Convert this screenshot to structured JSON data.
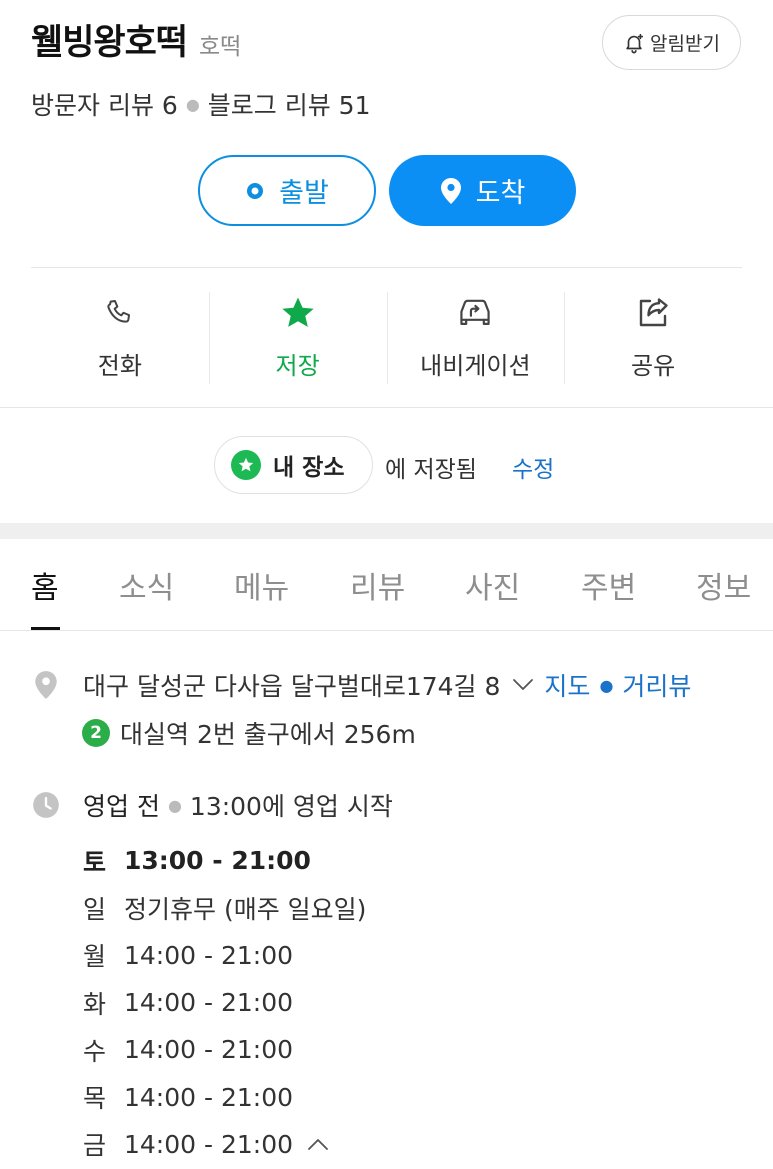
{
  "header": {
    "place_name": "웰빙왕호떡",
    "category": "호떡",
    "notify_label": "알림받기",
    "visitor_reviews_label": "방문자 리뷰 6",
    "blog_reviews_label": "블로그 리뷰 51"
  },
  "route": {
    "depart_label": "출발",
    "arrive_label": "도착"
  },
  "actions": [
    {
      "label": "전화",
      "icon": "phone-icon"
    },
    {
      "label": "저장",
      "icon": "star-icon"
    },
    {
      "label": "내비게이션",
      "icon": "car-icon"
    },
    {
      "label": "공유",
      "icon": "share-icon"
    }
  ],
  "saved": {
    "chip_label": "내 장소",
    "suffix_text": "에 저장됨",
    "edit_label": "수정"
  },
  "tabs": [
    {
      "label": "홈",
      "active": true
    },
    {
      "label": "소식"
    },
    {
      "label": "메뉴"
    },
    {
      "label": "리뷰"
    },
    {
      "label": "사진"
    },
    {
      "label": "주변"
    },
    {
      "label": "정보"
    }
  ],
  "address": {
    "text": "대구 달성군 다사읍 달구벌대로174길 8",
    "map_link": "지도",
    "street_view_link": "거리뷰",
    "subway_line": "2",
    "subway_text": "대실역 2번 출구에서 256m"
  },
  "hours": {
    "status": "영업 전",
    "status_detail": "13:00에 영업 시작",
    "schedule": [
      {
        "day": "토",
        "time": "13:00 - 21:00",
        "today": true
      },
      {
        "day": "일",
        "time": "정기휴무 (매주 일요일)"
      },
      {
        "day": "월",
        "time": "14:00 - 21:00"
      },
      {
        "day": "화",
        "time": "14:00 - 21:00"
      },
      {
        "day": "수",
        "time": "14:00 - 21:00"
      },
      {
        "day": "목",
        "time": "14:00 - 21:00"
      },
      {
        "day": "금",
        "time": "14:00 - 21:00"
      }
    ]
  },
  "colors": {
    "accent_blue": "#0c8ff5",
    "saved_green": "#0fa84a",
    "subway_line2_green": "#2bae4a",
    "link_blue": "#1a73c8"
  }
}
